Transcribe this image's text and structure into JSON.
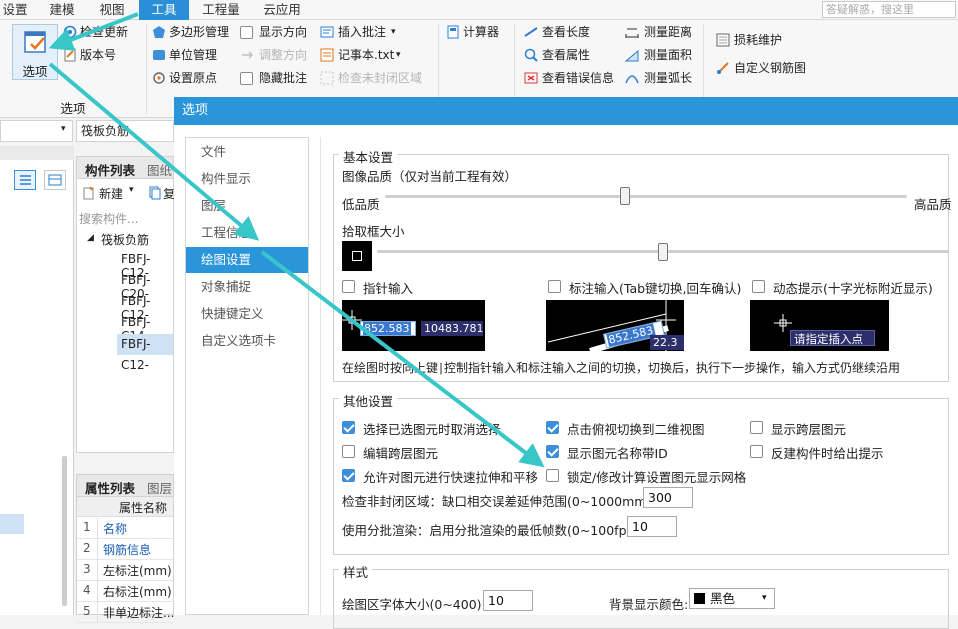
{
  "menubar": {
    "items": [
      "设置",
      "建模",
      "视图",
      "工具",
      "工程量",
      "云应用"
    ],
    "active": "工具",
    "search_placeholder": "答疑解惑，搜这里"
  },
  "ribbon": {
    "options_label": "选项",
    "group_label": "选项",
    "check_update": "检查更新",
    "version": "版本号",
    "polygon_mgmt": "多边形管理",
    "unit_mgmt": "单位管理",
    "set_origin": "设置原点",
    "show_direction": "显示方向",
    "adjust_direction": "调整方向",
    "hide_annotation": "隐藏批注",
    "insert_annotation": "插入批注",
    "notepad": "记事本.txt",
    "check_unclosed": "检查未封闭区域",
    "calculator": "计算器",
    "view_length": "查看长度",
    "view_properties": "查看属性",
    "view_errors": "查看错误信息",
    "measure_distance": "测量距离",
    "measure_area": "测量面积",
    "measure_arc": "测量弧长",
    "loss_maintenance": "损耗维护",
    "custom_rebar": "自定义钢筋图"
  },
  "left": {
    "dropdown_value": "筏板负筋",
    "component_tab": "构件列表",
    "graphic_tab": "图纸",
    "new_button": "新建",
    "copy_button": "复",
    "search_placeholder": "搜索构件...",
    "tree_parent": "筏板负筋",
    "tree_items": [
      "FBFJ-C12-",
      "FBFJ-C20-",
      "FBFJ-C12-",
      "FBFJ-C14-",
      "FBFJ-C12-"
    ],
    "prop_tab": "属性列表",
    "layer_tab": "图层",
    "prop_header": "属性名称",
    "props": [
      {
        "num": "1",
        "name": "名称",
        "link": true
      },
      {
        "num": "2",
        "name": "钢筋信息",
        "link": true
      },
      {
        "num": "3",
        "name": "左标注(mm)",
        "link": false
      },
      {
        "num": "4",
        "name": "右标注(mm)",
        "link": false
      },
      {
        "num": "5",
        "name": "非单边标注...",
        "link": false
      }
    ]
  },
  "dialog": {
    "title": "选项",
    "nav": [
      "文件",
      "构件显示",
      "图层",
      "工程信息",
      "绘图设置",
      "对象捕捉",
      "快捷键定义",
      "自定义选项卡"
    ],
    "active_nav": "绘图设置",
    "basic": {
      "legend": "基本设置",
      "quality_label": "图像品质（仅对当前工程有效）",
      "low_quality": "低品质",
      "high_quality": "高品质",
      "quality_level": 0.46,
      "pick_box_label": "拾取框大小",
      "pick_box_level": 0.5,
      "pointer_input": "指针输入",
      "dimension_input": "标注输入(Tab键切换,回车确认)",
      "dynamic_prompt": "动态提示(十字光标附近显示)",
      "preview1_val1": "852.583",
      "preview1_val2": "10483.781",
      "preview2_val1": "852.583",
      "preview2_val2": "22.3",
      "preview3_text": "请指定插入点",
      "hint": "在绘图时按向上键∣控制指针输入和标注输入之间的切换，切换后，执行下一步操作，输入方式仍继续沿用"
    },
    "other": {
      "legend": "其他设置",
      "options": [
        {
          "label": "选择已选图元时取消选择",
          "checked": true
        },
        {
          "label": "点击俯视切换到二维视图",
          "checked": true
        },
        {
          "label": "显示跨层图元",
          "checked": false
        },
        {
          "label": "编辑跨层图元",
          "checked": false
        },
        {
          "label": "显示图元名称带ID",
          "checked": true
        },
        {
          "label": "反建构件时给出提示",
          "checked": false
        },
        {
          "label": "允许对图元进行快速拉伸和平移",
          "checked": true
        },
        {
          "label": "锁定/修改计算设置图元显示网格",
          "checked": false
        }
      ],
      "gap_label": "检查非封闭区域：缺口相交误差延伸范围(0~1000mm):",
      "gap_value": "300",
      "batch_label": "使用分批渲染：启用分批渲染的最低帧数(0~100fps):",
      "batch_value": "10"
    },
    "style": {
      "legend": "样式",
      "font_label": "绘图区字体大小(0~400):",
      "font_value": "10",
      "bg_label": "背景显示颜色:",
      "bg_value": "黑色"
    }
  },
  "colors": {
    "accent": "#2b95d9",
    "arrow": "#39c6c9",
    "link": "#1a5fb4"
  }
}
